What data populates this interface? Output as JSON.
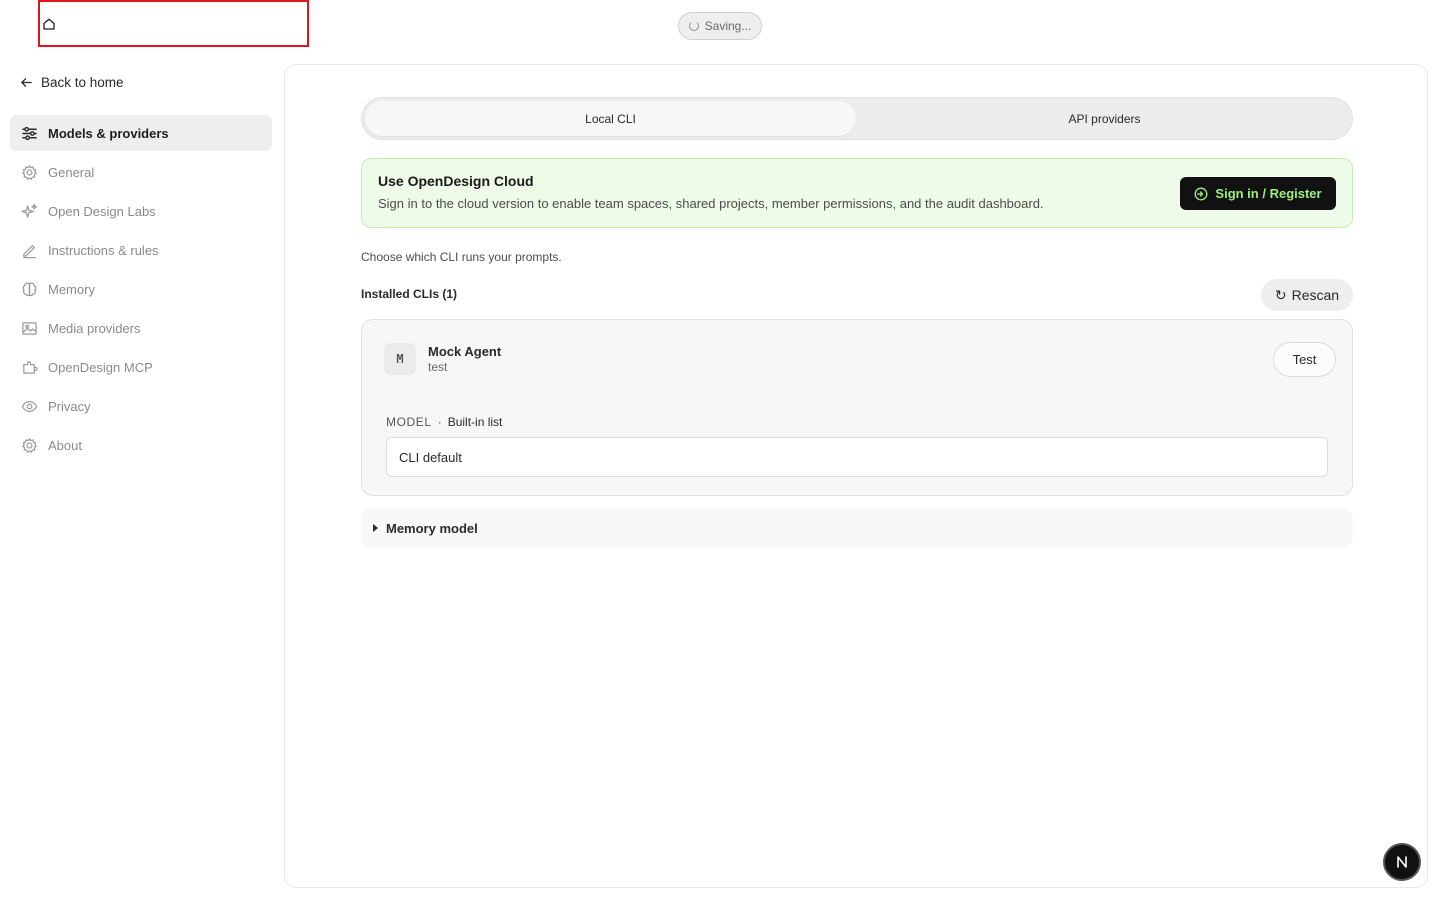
{
  "topbar": {
    "home_icon": "home-icon",
    "saving_label": "Saving..."
  },
  "sidebar": {
    "back_label": "Back to home",
    "items": [
      {
        "label": "Models & providers",
        "icon": "sliders-icon",
        "active": true
      },
      {
        "label": "General",
        "icon": "gear-icon",
        "active": false
      },
      {
        "label": "Open Design Labs",
        "icon": "sparkle-icon",
        "active": false
      },
      {
        "label": "Instructions & rules",
        "icon": "pencil-icon",
        "active": false
      },
      {
        "label": "Memory",
        "icon": "brain-icon",
        "active": false
      },
      {
        "label": "Media providers",
        "icon": "image-icon",
        "active": false
      },
      {
        "label": "OpenDesign MCP",
        "icon": "plugin-icon",
        "active": false
      },
      {
        "label": "Privacy",
        "icon": "eye-icon",
        "active": false
      },
      {
        "label": "About",
        "icon": "gear-icon",
        "active": false
      }
    ]
  },
  "main": {
    "tabs": [
      {
        "label": "Local CLI",
        "active": true
      },
      {
        "label": "API providers",
        "active": false
      }
    ],
    "banner": {
      "title": "Use OpenDesign Cloud",
      "description": "Sign in to the cloud version to enable team spaces, shared projects, member permissions, and the audit dashboard.",
      "button_label": "Sign in / Register"
    },
    "choose_text": "Choose which CLI runs your prompts.",
    "installed_label": "Installed CLIs (1)",
    "rescan_label": "Rescan",
    "cli": {
      "avatar_letter": "M",
      "name": "Mock Agent",
      "subtitle": "test",
      "test_label": "Test",
      "model_label": "MODEL",
      "model_separator": "·",
      "model_source": "Built-in list",
      "model_value": "CLI default"
    },
    "memory_model_label": "Memory model"
  },
  "colors": {
    "accent_green_text": "#9ef07a",
    "banner_bg": "#eefbe8",
    "highlight_box": "#e0141b"
  }
}
